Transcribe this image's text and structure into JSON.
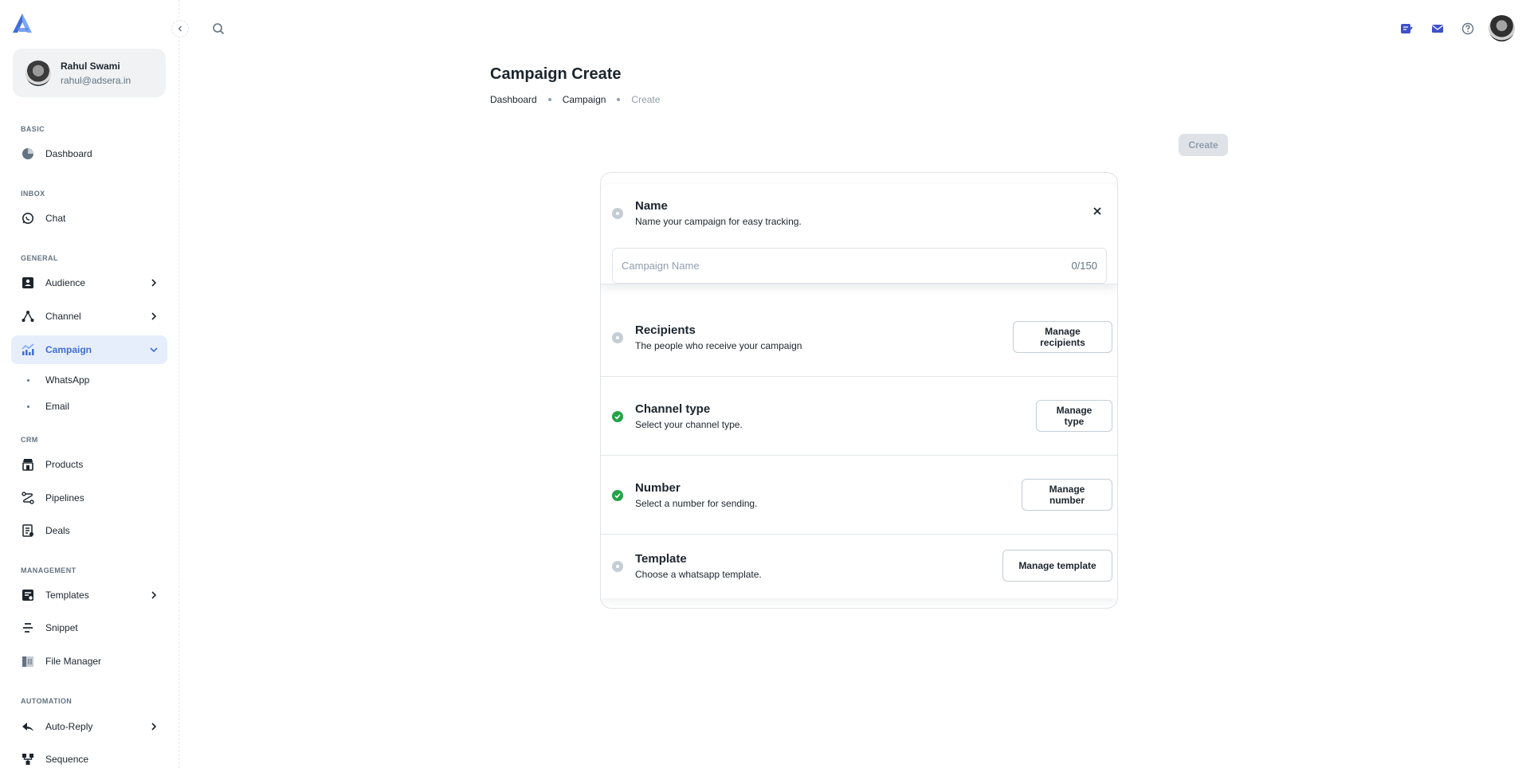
{
  "app": {
    "brand_color": "#3f6fd8"
  },
  "sidebar": {
    "user": {
      "name": "Rahul Swami",
      "email": "rahul@adsera.in"
    },
    "sections": {
      "basic": "BASIC",
      "inbox": "INBOX",
      "general": "GENERAL",
      "crm": "CRM",
      "management": "MANAGEMENT",
      "automation": "AUTOMATION"
    },
    "items": {
      "dashboard": "Dashboard",
      "chat": "Chat",
      "audience": "Audience",
      "channel": "Channel",
      "campaign": "Campaign",
      "whatsapp": "WhatsApp",
      "email": "Email",
      "products": "Products",
      "pipelines": "Pipelines",
      "deals": "Deals",
      "templates": "Templates",
      "snippet": "Snippet",
      "file_manager": "File Manager",
      "auto_reply": "Auto-Reply",
      "sequence": "Sequence"
    },
    "active_item": "Campaign"
  },
  "header": {
    "icons": [
      "search-icon",
      "notes-icon",
      "mail-icon",
      "help-icon",
      "avatar"
    ]
  },
  "page": {
    "title": "Campaign Create",
    "breadcrumb": [
      "Dashboard",
      "Campaign",
      "Create"
    ],
    "create_label": "Create"
  },
  "steps": {
    "name": {
      "title": "Name",
      "desc": "Name your campaign for easy tracking.",
      "placeholder": "Campaign Name",
      "counter": "0/150",
      "status": "pending"
    },
    "recipients": {
      "title": "Recipients",
      "desc": "The people who receive your campaign",
      "button": "Manage recipients",
      "status": "pending"
    },
    "channel_type": {
      "title": "Channel type",
      "desc": "Select your channel type.",
      "button": "Manage type",
      "status": "done"
    },
    "number": {
      "title": "Number",
      "desc": "Select a number for sending.",
      "button": "Manage number",
      "status": "done"
    },
    "template": {
      "title": "Template",
      "desc": "Choose a whatsapp template.",
      "button": "Manage template",
      "status": "pending"
    }
  }
}
